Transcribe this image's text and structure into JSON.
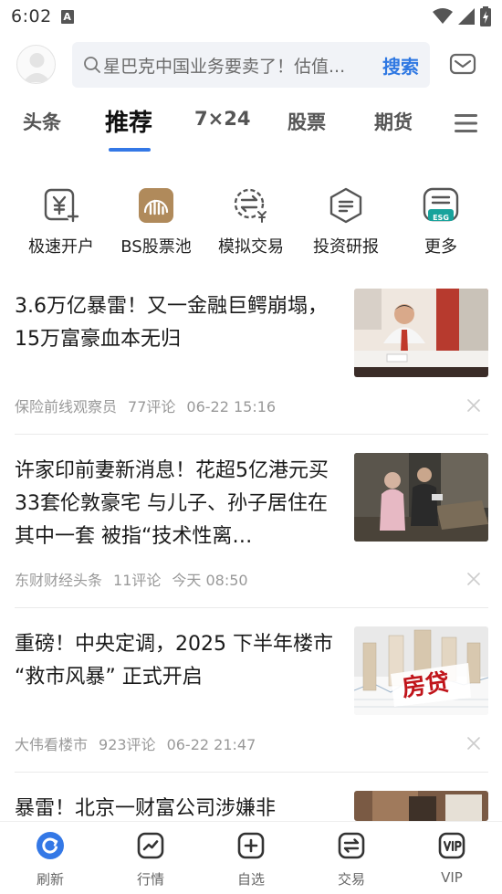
{
  "status_bar": {
    "time": "6:02",
    "indicator": "A"
  },
  "header": {
    "search_placeholder": "星巴克中国业务要卖了！估值...",
    "search_button": "搜索"
  },
  "tabs": [
    {
      "label": "头条"
    },
    {
      "label": "推荐",
      "active": true
    },
    {
      "label": "7×24"
    },
    {
      "label": "股票"
    },
    {
      "label": "期货"
    }
  ],
  "quick_entries": [
    {
      "label": "极速开户",
      "icon": "account-open-icon"
    },
    {
      "label": "BS股票池",
      "icon": "stock-pool-icon"
    },
    {
      "label": "模拟交易",
      "icon": "simulated-trade-icon"
    },
    {
      "label": "投资研报",
      "icon": "research-report-icon"
    },
    {
      "label": "更多",
      "icon": "esg-more-icon",
      "badge": "ESG"
    }
  ],
  "news": [
    {
      "title": "3.6万亿暴雷！又一金融巨鳄崩塌，15万富豪血本无归",
      "source": "保险前线观察员",
      "comments": "77评论",
      "time": "06-22 15:16"
    },
    {
      "title": "许家印前妻新消息！花超5亿港元买33套伦敦豪宅 与儿子、孙子居住在其中一套 被指“技术性离…",
      "source": "东财财经头条",
      "comments": "11评论",
      "time": "今天 08:50"
    },
    {
      "title": "重磅！中央定调，2025 下半年楼市 “救市风暴” 正式开启",
      "source": "大伟看楼市",
      "comments": "923评论",
      "time": "06-22 21:47",
      "image_text": "房贷"
    },
    {
      "title": "暴雷！北京一财富公司涉嫌非"
    }
  ],
  "bottom_nav": [
    {
      "label": "刷新",
      "icon": "refresh-icon",
      "active": true
    },
    {
      "label": "行情",
      "icon": "market-icon"
    },
    {
      "label": "自选",
      "icon": "watchlist-add-icon"
    },
    {
      "label": "交易",
      "icon": "trade-icon"
    },
    {
      "label": "VIP",
      "icon": "vip-icon"
    }
  ],
  "colors": {
    "accent": "#3478e6",
    "search_button": "#2f78e2",
    "esg_badge": "#18a39c",
    "stock_pool_icon": "#b08a5b"
  }
}
